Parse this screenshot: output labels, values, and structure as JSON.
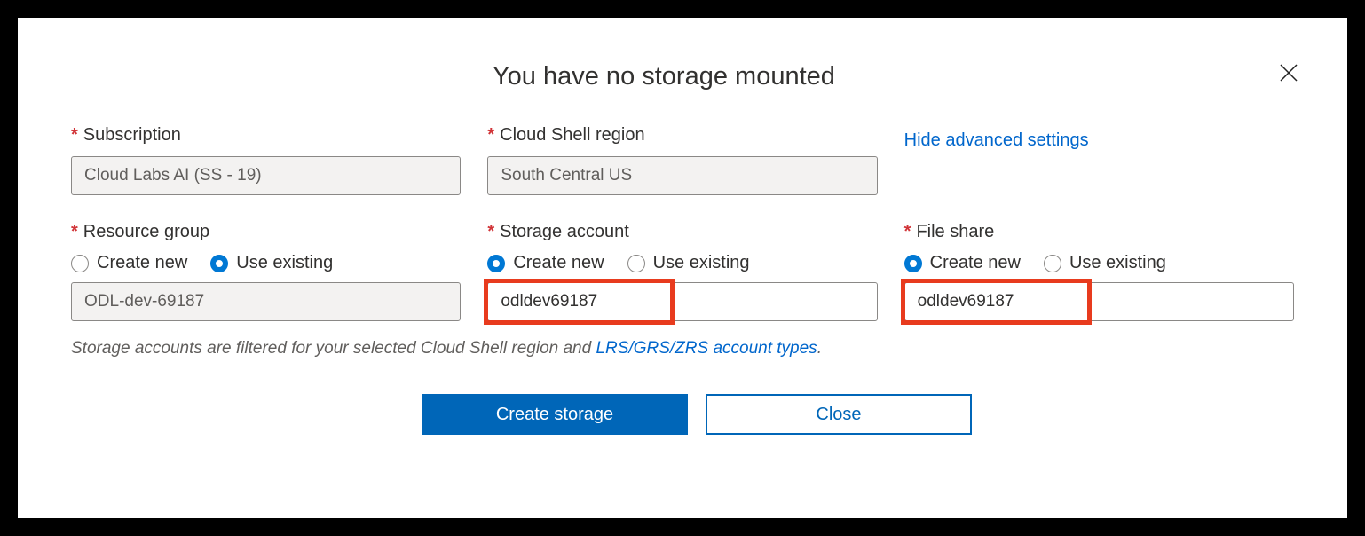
{
  "title": "You have no storage mounted",
  "labels": {
    "subscription": "Subscription",
    "region": "Cloud Shell region",
    "resource_group": "Resource group",
    "storage_account": "Storage account",
    "file_share": "File share"
  },
  "values": {
    "subscription": "Cloud Labs AI (SS - 19)",
    "region": "South Central US",
    "resource_group": "ODL-dev-69187",
    "storage_account": "odldev69187",
    "file_share": "odldev69187"
  },
  "radio": {
    "create_new": "Create new",
    "use_existing": "Use existing"
  },
  "link_hide_advanced": "Hide advanced settings",
  "filter_note_prefix": "Storage accounts are filtered for your selected Cloud Shell region and ",
  "filter_note_link": "LRS/GRS/ZRS account types",
  "filter_note_suffix": ".",
  "buttons": {
    "create": "Create storage",
    "close": "Close"
  }
}
